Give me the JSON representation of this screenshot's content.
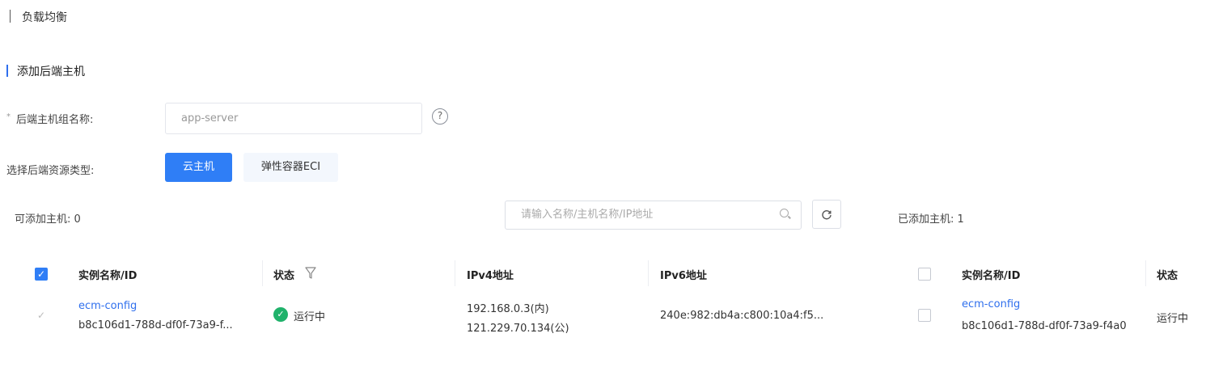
{
  "header": {
    "breadcrumb": "负载均衡"
  },
  "section": {
    "title": "添加后端主机"
  },
  "form": {
    "group_name_label": "后端主机组名称:",
    "group_name_required": "*",
    "group_name_value": "app-server",
    "help_glyph": "?",
    "resource_type_label": "选择后端资源类型:",
    "resource_types": [
      "云主机",
      "弹性容器ECI"
    ]
  },
  "toolbar": {
    "addable_label": "可添加主机:",
    "addable_count": "0",
    "search_placeholder": "请输入名称/主机名称/IP地址",
    "added_label": "已添加主机:",
    "added_count": "1"
  },
  "left_table": {
    "columns": [
      "实例名称/ID",
      "状态",
      "IPv4地址",
      "IPv6地址"
    ],
    "rows": [
      {
        "name": "ecm-config",
        "id": "b8c106d1-788d-df0f-73a9-f...",
        "status": "运行中",
        "ipv4_internal": "192.168.0.3(内)",
        "ipv4_public": "121.229.70.134(公)",
        "ipv6": "240e:982:db4a:c800:10a4:f5..."
      }
    ]
  },
  "right_table": {
    "columns": [
      "实例名称/ID",
      "状态"
    ],
    "rows": [
      {
        "name": "ecm-config",
        "id": "b8c106d1-788d-df0f-73a9-f4a0",
        "status": "运行中"
      }
    ]
  },
  "colors": {
    "primary": "#2f7ef6",
    "success": "#20b26b",
    "link": "#2f6fed"
  },
  "icons": {
    "filter": "filter-icon",
    "refresh": "refresh-icon",
    "search": "search-icon",
    "help": "help-icon"
  }
}
